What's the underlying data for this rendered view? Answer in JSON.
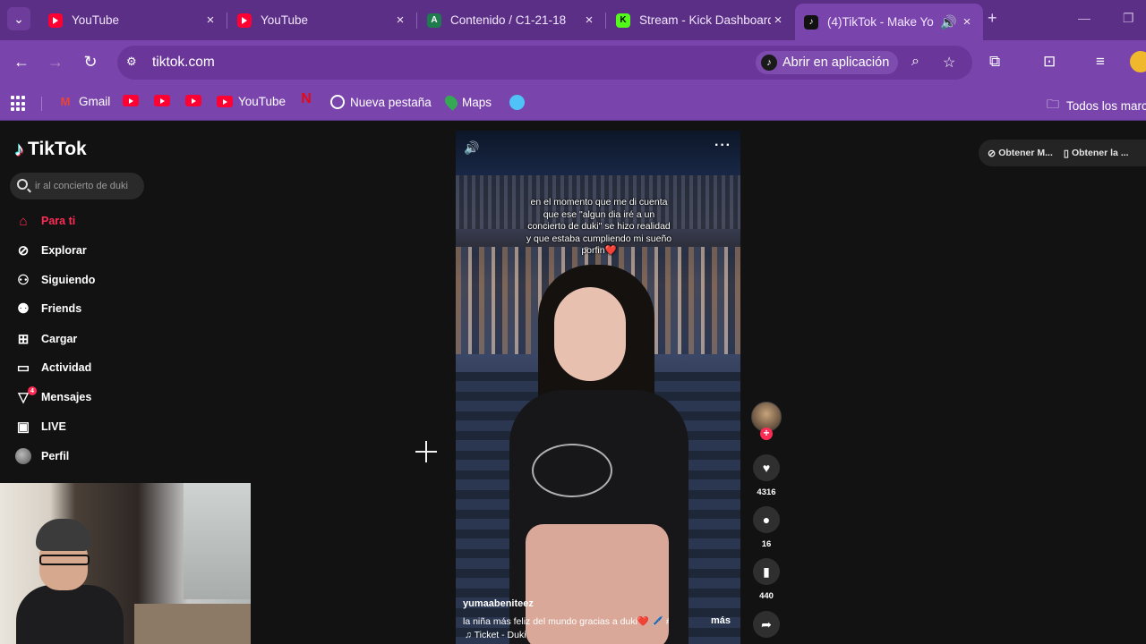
{
  "browser": {
    "tabs": [
      {
        "title": "YouTube",
        "favicon": "youtube-icon",
        "active": false
      },
      {
        "title": "YouTube",
        "favicon": "youtube-icon",
        "active": false
      },
      {
        "title": "Contenido / C1-21-18",
        "favicon": "app-a-icon",
        "active": false
      },
      {
        "title": "Stream - Kick Dashboard",
        "favicon": "kick-icon",
        "active": false
      },
      {
        "title": "(4)TikTok - Make Yo",
        "favicon": "tiktok-icon",
        "active": true
      }
    ],
    "favicon_letters": {
      "a": "A",
      "k": "K"
    },
    "close_glyph": "×",
    "url": "tiktok.com",
    "open_in_app": "Abrir en aplicación",
    "bookmarks": [
      {
        "label": "Gmail",
        "icon": "gmail-icon"
      },
      {
        "label": "",
        "icon": "youtube-icon"
      },
      {
        "label": "",
        "icon": "youtube-icon"
      },
      {
        "label": "",
        "icon": "youtube-icon"
      },
      {
        "label": "YouTube",
        "icon": "youtube-icon"
      },
      {
        "label": "",
        "icon": "netflix-icon"
      },
      {
        "label": "Nueva pestaña",
        "icon": "globe-icon"
      },
      {
        "label": "Maps",
        "icon": "maps-icon"
      },
      {
        "label": "",
        "icon": "lens-icon"
      }
    ],
    "all_bookmarks": "Todos los marc",
    "colors": {
      "frame": "#5b2f86",
      "toolbar": "#7a44ad"
    }
  },
  "tiktok": {
    "logo": "TikTok",
    "search_placeholder": "ir al concierto de duki",
    "nav": [
      {
        "label": "Para ti",
        "icon": "home-icon",
        "active": true
      },
      {
        "label": "Explorar",
        "icon": "compass-icon"
      },
      {
        "label": "Siguiendo",
        "icon": "following-icon"
      },
      {
        "label": "Friends",
        "icon": "friends-icon"
      },
      {
        "label": "Cargar",
        "icon": "upload-icon"
      },
      {
        "label": "Actividad",
        "icon": "activity-icon"
      },
      {
        "label": "Mensajes",
        "icon": "messages-icon",
        "badge": "4"
      },
      {
        "label": "LIVE",
        "icon": "live-icon"
      },
      {
        "label": "Perfil",
        "icon": "profile-avatar"
      }
    ],
    "video": {
      "caption_lines": [
        "en el momento que me di cuenta",
        "que ese \"algun dia iré a un",
        "concierto de duki\" se hizo realidad",
        "y que estaba cumpliendo mi sueño",
        "porfin❤️"
      ],
      "username": "yumaabeniteez",
      "description": "la niña más feliz del mundo gracias a duki❤️ 🖊️ #fyp ...",
      "more": "más",
      "music": "♫  Ticket - Duki"
    },
    "actions": {
      "likes": "4316",
      "comments": "16",
      "saves": "440"
    },
    "get_buttons": [
      "Obtener M...",
      "Obtener la ..."
    ],
    "accent": "#fe2c55"
  }
}
